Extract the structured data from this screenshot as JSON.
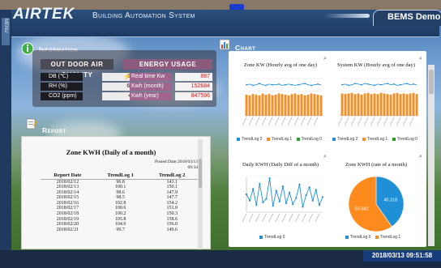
{
  "header": {
    "brand": "AIRTEK",
    "subtitle": "Building Automation System",
    "demo": "BEMS Demo",
    "menu": "MENU"
  },
  "sections": {
    "information": "Information",
    "report": "Report",
    "chart": "Chart"
  },
  "outdoor_air": {
    "title": "OUT DOOR AIR QUALITY",
    "rows": [
      {
        "label": "DB (℃)",
        "value": "26.8",
        "icon": "thermometer-icon"
      },
      {
        "label": "RH (%)",
        "value": "63.4",
        "icon": "humidity-icon"
      },
      {
        "label": "CO2 (ppm)",
        "value": "413",
        "icon": "cloud-icon"
      }
    ]
  },
  "energy": {
    "title": "ENERGY USAGE",
    "rows": [
      {
        "label": "Real time Kw",
        "value": "887"
      },
      {
        "label": "Kwh (month)",
        "value": "152684"
      },
      {
        "label": "Kwh (year)",
        "value": "847596"
      }
    ]
  },
  "report": {
    "heading": "Zone KWH (Daily of a month)",
    "posted": "Posted Date:2018/03/13",
    "posted_time": "09:34",
    "columns": [
      "Report Date",
      "TrendLog 1",
      "TrendLog 2"
    ],
    "rows": [
      [
        "2018/02/12",
        "96.8",
        "143.1"
      ],
      [
        "2018/02/13",
        "100.1",
        "150.1"
      ],
      [
        "2018/02/14",
        "98.6",
        "147.9"
      ],
      [
        "2018/02/15",
        "98.5",
        "147.7"
      ],
      [
        "2018/02/16",
        "102.8",
        "154.2"
      ],
      [
        "2018/02/17",
        "100.6",
        "151.0"
      ],
      [
        "2018/02/18",
        "100.2",
        "150.3"
      ],
      [
        "2018/02/19",
        "105.8",
        "158.6"
      ],
      [
        "2018/02/20",
        "104.0",
        "156.0"
      ],
      [
        "2018/02/21",
        "99.7",
        "149.6"
      ]
    ]
  },
  "colors": {
    "trend0": "#1f8fd6",
    "trend1": "#ff8a1d",
    "trend2": "#2ca02c",
    "accent": "#163c7a"
  },
  "charts": {
    "zone_kw": {
      "title": "Zone KW (Hourly avg of one day)",
      "legend": [
        "TrendLog 2",
        "TrendLog 1",
        "TrendLog 0"
      ]
    },
    "system_kw": {
      "title": "System KW (Hourly avg of one day)",
      "legend": [
        "TrendLog 2",
        "TrendLog 1",
        "TrendLog 0"
      ]
    },
    "daily_kwh": {
      "title": "Daily KWH (Daily Diff of a month)",
      "legend": [
        "TrendLog 0"
      ]
    },
    "zone_kwh": {
      "title": "Zone KWH (rate of a month)",
      "legend": [
        "TrendLog 0",
        "TrendLog 1"
      ]
    }
  },
  "chart_data": [
    {
      "type": "bar",
      "title": "Zone KW (Hourly avg of one day)",
      "series": [
        {
          "name": "TrendLog 1",
          "values": [
            3.4,
            3.3,
            3.5,
            3.4,
            3.3,
            3.6,
            3.4,
            3.5,
            3.3,
            3.4,
            3.6,
            3.5,
            3.4,
            3.3,
            3.5,
            3.6,
            3.4,
            3.5,
            3.3,
            3.4,
            3.6,
            3.5,
            3.4,
            3.3
          ]
        },
        {
          "name": "TrendLog 2",
          "values": [
            5.0,
            5.1,
            4.9,
            5.0,
            5.2,
            5.0,
            4.9,
            5.1,
            5.0,
            5.0,
            5.1,
            4.9,
            5.0,
            5.1,
            5.0,
            4.9,
            5.0,
            5.1,
            5.2,
            5.0,
            4.9,
            5.0,
            5.1,
            5.0
          ]
        }
      ]
    },
    {
      "type": "bar",
      "title": "System KW (Hourly avg of one day)",
      "series": [
        {
          "name": "TrendLog 1",
          "values": [
            3.6,
            3.5,
            3.6,
            3.7,
            3.5,
            3.6,
            3.4,
            3.6,
            3.7,
            3.5,
            3.6,
            3.5,
            3.7,
            3.6,
            3.5,
            3.4,
            3.6,
            3.7,
            3.5,
            3.6,
            3.5,
            3.6,
            3.7,
            3.5
          ]
        },
        {
          "name": "TrendLog 2",
          "values": [
            5.0,
            5.1,
            4.9,
            5.0,
            5.2,
            5.1,
            5.0,
            5.2,
            5.1,
            5.0,
            4.9,
            5.1,
            5.0,
            5.1,
            5.2,
            5.0,
            5.1,
            4.9,
            5.0,
            5.1,
            5.2,
            5.0,
            5.1,
            5.0
          ]
        }
      ]
    },
    {
      "type": "line",
      "title": "Daily KWH (Daily Diff of a month)",
      "series": [
        {
          "name": "TrendLog 0",
          "values": [
            2.0,
            1.3,
            2.6,
            0.8,
            3.2,
            1.1,
            1.5,
            3.8,
            0.7,
            2.4,
            1.2,
            2.9,
            1.0,
            2.2,
            0.9,
            1.6,
            3.1,
            0.6,
            1.9,
            2.8,
            1.3,
            2.5,
            0.8,
            1.7
          ]
        }
      ]
    },
    {
      "type": "pie",
      "title": "Zone KWH (rate of a month)",
      "series": [
        {
          "name": "TrendLog 0",
          "values": [
            40.318
          ]
        },
        {
          "name": "TrendLog 1",
          "values": [
            59.682
          ]
        }
      ]
    }
  ],
  "status": {
    "clock": "2018/03/13 09:51:58"
  }
}
